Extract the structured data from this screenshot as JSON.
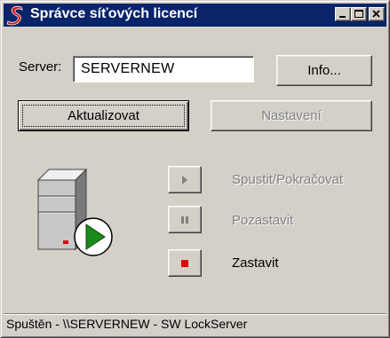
{
  "window": {
    "title": "Správce síťových licencí",
    "controls": {
      "minimize": "minimize",
      "maximize": "maximize",
      "close": "close"
    }
  },
  "server": {
    "label": "Server:",
    "value": "SERVERNEW",
    "info_button": "Info..."
  },
  "buttons": {
    "refresh": "Aktualizovat",
    "settings": "Nastavení"
  },
  "service_actions": {
    "start": {
      "label": "Spustit/Pokračovat",
      "enabled": false
    },
    "pause": {
      "label": "Pozastavit",
      "enabled": false
    },
    "stop": {
      "label": "Zastavit",
      "enabled": true
    }
  },
  "status": {
    "text": "Spuštěn - \\\\SERVERNEW - SW LockServer"
  },
  "colors": {
    "titlebar": "#0a246a",
    "face": "#d4d0c8",
    "stop_red": "#e00000",
    "play_green": "#1a8a1a",
    "logo_red": "#d01010"
  },
  "icons": {
    "app": "app-s-logo-icon",
    "server": "server-running-icon",
    "start": "play-icon",
    "pause": "pause-icon",
    "stop": "stop-icon"
  }
}
